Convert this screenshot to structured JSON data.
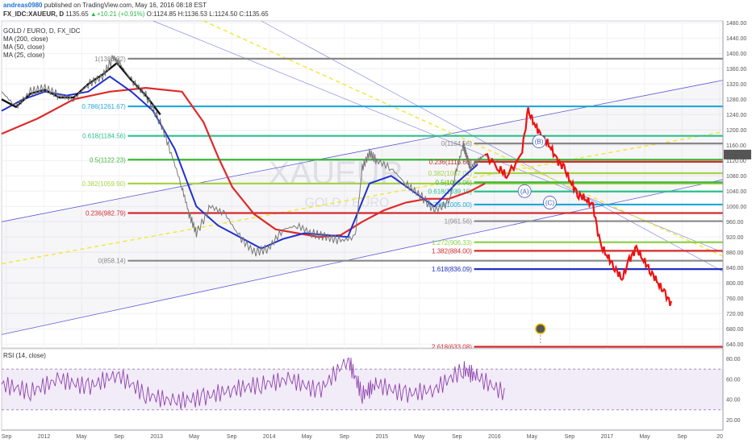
{
  "header": {
    "user": "andreas0980",
    "published": " published on TradingView.com, May 16, 2016 08:18 EST",
    "symbol": "FX_IDC:XAUEUR, D",
    "price": " 1135.65",
    "change": "+10.21 (+0.91%)",
    "ohlc": " O:1124.85 H:1136.53 L:1124.50 C:1135.65"
  },
  "legend": {
    "title": "GOLD / EURO, D, FX_IDC",
    "ma200": "MA (200, close)",
    "ma50": "MA (50, close)",
    "ma25": "MA (25, close)"
  },
  "watermark": {
    "big": "XAUEUR",
    "small": "GOLD / EURO"
  },
  "rsi_label": "RSI (14, close)",
  "colors": {
    "price": "#1a1a1a",
    "ma200": "#e02a2a",
    "ma50": "#2030d0",
    "ma25": "#111111",
    "forecast": "#ee1111",
    "rsi": "#8e44ad",
    "channel": "#5b5bd6",
    "dashed": "#f2e73a"
  },
  "chart_data": [
    {
      "type": "line",
      "title": "GOLD / EURO, D, FX_IDC",
      "x_ticks": [
        "Sep",
        "2012",
        "May",
        "Sep",
        "2013",
        "May",
        "Sep",
        "2014",
        "May",
        "Sep",
        "2015",
        "May",
        "Sep",
        "2016",
        "May",
        "Sep",
        "2017",
        "May",
        "Sep",
        "20"
      ],
      "y_ticks": [
        640,
        680,
        720,
        760,
        800,
        840,
        880,
        920,
        960,
        1000,
        1040,
        1080,
        1120,
        1160,
        1200,
        1240,
        1280,
        1320,
        1360,
        1400,
        1440,
        1480
      ],
      "ylim": [
        630,
        1485
      ],
      "last_price": "1135.65",
      "fibonacci_levels_left": [
        {
          "label": "1(1386.32)",
          "value": 1386.32,
          "color": "#888888"
        },
        {
          "label": "0.786(1261.67)",
          "value": 1261.67,
          "color": "#20a8d8"
        },
        {
          "label": "0.618(1184.56)",
          "value": 1184.56,
          "color": "#2bc08a"
        },
        {
          "label": "0.5(1122.23)",
          "value": 1122.23,
          "color": "#3cb63c"
        },
        {
          "label": "0.382(1059.90)",
          "value": 1059.9,
          "color": "#a6d24a"
        },
        {
          "label": "0.236(982.79)",
          "value": 982.79,
          "color": "#d42b2b"
        },
        {
          "label": "0(858.14)",
          "value": 858.14,
          "color": "#888888"
        }
      ],
      "fibonacci_levels_right": [
        {
          "label": "0(1164.56)",
          "value": 1164.56,
          "color": "#888888"
        },
        {
          "label": "0.236(1116.66)",
          "value": 1116.66,
          "color": "#d42b2b"
        },
        {
          "label": "0.382(1087.01)",
          "value": 1087.01,
          "color": "#a6d24a"
        },
        {
          "label": "0.5(1063.06)",
          "value": 1063.06,
          "color": "#3cb63c"
        },
        {
          "label": "0.618(1039.10)",
          "value": 1039.1,
          "color": "#2bc08a"
        },
        {
          "label": "0.786(1005.00)",
          "value": 1005.0,
          "color": "#20a8d8"
        },
        {
          "label": "1(961.56)",
          "value": 961.56,
          "color": "#888888"
        },
        {
          "label": "1.272(906.33)",
          "value": 906.33,
          "color": "#8ed04a"
        },
        {
          "label": "1.382(884.00)",
          "value": 884.0,
          "color": "#d42b2b"
        },
        {
          "label": "1.618(836.09)",
          "value": 836.09,
          "color": "#2030c0"
        },
        {
          "label": "2.618(633.08)",
          "value": 633.08,
          "color": "#d42b2b"
        }
      ],
      "wave_labels": [
        "(B)",
        "(A)",
        "(C)"
      ],
      "series": [
        {
          "name": "XAUEUR",
          "color": "#1a1a1a",
          "x": [
            0,
            0.02,
            0.04,
            0.06,
            0.08,
            0.1,
            0.12,
            0.14,
            0.155,
            0.165,
            0.18,
            0.2,
            0.22,
            0.235,
            0.25,
            0.26,
            0.27,
            0.29,
            0.31,
            0.33,
            0.35,
            0.37,
            0.39,
            0.41,
            0.43,
            0.45,
            0.47,
            0.49,
            0.5,
            0.51,
            0.52,
            0.54,
            0.56,
            0.58,
            0.6,
            0.62,
            0.63,
            0.64,
            0.645,
            0.65,
            0.66,
            0.67
          ],
          "values": [
            1300,
            1260,
            1300,
            1310,
            1290,
            1280,
            1320,
            1340,
            1390,
            1370,
            1330,
            1290,
            1220,
            1140,
            1050,
            980,
            930,
            1000,
            980,
            920,
            880,
            890,
            940,
            950,
            930,
            920,
            910,
            920,
            1100,
            1140,
            1120,
            1100,
            1060,
            1030,
            990,
            1010,
            1090,
            1160,
            1130,
            1100,
            1120,
            1135
          ]
        },
        {
          "name": "MA (200, close)",
          "color": "#e02a2a",
          "x": [
            0,
            0.05,
            0.1,
            0.15,
            0.2,
            0.25,
            0.28,
            0.3,
            0.32,
            0.35,
            0.38,
            0.41,
            0.44,
            0.47,
            0.5,
            0.53,
            0.56,
            0.59,
            0.62,
            0.65,
            0.67
          ],
          "values": [
            1190,
            1230,
            1280,
            1300,
            1310,
            1300,
            1220,
            1130,
            1050,
            980,
            940,
            930,
            920,
            925,
            960,
            990,
            1010,
            1020,
            1020,
            1040,
            1060
          ]
        },
        {
          "name": "MA (50, close)",
          "color": "#2030d0",
          "x": [
            0,
            0.03,
            0.06,
            0.09,
            0.12,
            0.15,
            0.18,
            0.21,
            0.24,
            0.27,
            0.3,
            0.33,
            0.36,
            0.39,
            0.42,
            0.45,
            0.48,
            0.51,
            0.54,
            0.57,
            0.6,
            0.63,
            0.66
          ],
          "values": [
            1250,
            1280,
            1300,
            1290,
            1300,
            1340,
            1300,
            1250,
            1150,
            1000,
            950,
            920,
            890,
            915,
            930,
            925,
            920,
            1060,
            1080,
            1040,
            1000,
            1060,
            1110
          ]
        },
        {
          "name": "MA (25, close)",
          "color": "#111111",
          "x": [
            0,
            0.02,
            0.04,
            0.06,
            0.08,
            0.1,
            0.12,
            0.14,
            0.16,
            0.18,
            0.2,
            0.22
          ],
          "values": [
            1280,
            1260,
            1295,
            1305,
            1285,
            1285,
            1320,
            1345,
            1375,
            1330,
            1290,
            1240
          ]
        },
        {
          "name": "Forecast",
          "color": "#ee1111",
          "x": [
            0.67,
            0.69,
            0.7,
            0.72,
            0.73,
            0.74,
            0.75,
            0.76,
            0.77,
            0.78,
            0.79,
            0.8,
            0.81,
            0.82,
            0.83,
            0.84,
            0.85,
            0.86,
            0.87,
            0.88,
            0.89,
            0.9,
            0.91,
            0.92,
            0.93
          ],
          "values": [
            1135,
            1100,
            1080,
            1130,
            1250,
            1210,
            1180,
            1160,
            1120,
            1100,
            1060,
            1030,
            1020,
            1000,
            900,
            870,
            840,
            810,
            860,
            890,
            860,
            830,
            800,
            770,
            740
          ]
        }
      ]
    },
    {
      "type": "line",
      "title": "RSI (14, close)",
      "y_ticks": [
        20,
        40,
        60,
        80
      ],
      "ylim": [
        10,
        90
      ],
      "bands": [
        30,
        70
      ],
      "series": [
        {
          "name": "RSI (14, close)",
          "color": "#8e44ad",
          "x": [
            0,
            0.04,
            0.08,
            0.12,
            0.16,
            0.2,
            0.24,
            0.28,
            0.32,
            0.36,
            0.4,
            0.44,
            0.48,
            0.5,
            0.52,
            0.56,
            0.6,
            0.64,
            0.66,
            0.7
          ],
          "values": [
            55,
            48,
            60,
            52,
            65,
            45,
            38,
            42,
            50,
            55,
            60,
            48,
            80,
            45,
            55,
            45,
            50,
            70,
            62,
            45
          ]
        }
      ]
    }
  ]
}
